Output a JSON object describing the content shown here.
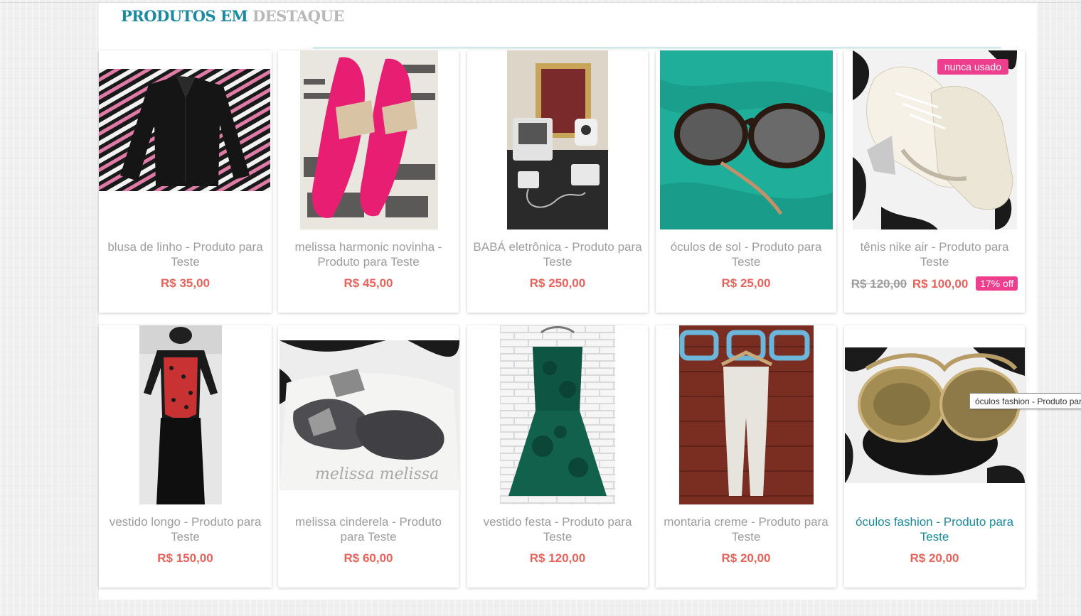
{
  "section": {
    "title_part1": "PRODUTOS EM",
    "title_part2": "DESTAQUE"
  },
  "products": [
    {
      "name": "blusa de linho - Produto para Teste",
      "price": "R$ 35,00",
      "image": "black-blouse-photo"
    },
    {
      "name": "melissa harmonic novinha - Produto para Teste",
      "price": "R$ 45,00",
      "image": "pink-sandals-photo"
    },
    {
      "name": "BABÁ eletrônica - Produto para Teste",
      "price": "R$ 250,00",
      "image": "baby-monitor-photo"
    },
    {
      "name": "óculos de sol - Produto para Teste",
      "price": "R$ 25,00",
      "image": "sunglasses-photo"
    },
    {
      "name": "tênis nike air - Produto para Teste",
      "old_price": "R$ 120,00",
      "price": "R$ 100,00",
      "discount": "17% off",
      "badge": "nunca usado",
      "image": "sneakers-photo"
    },
    {
      "name": "vestido longo - Produto para Teste",
      "price": "R$ 150,00",
      "image": "long-dress-photo"
    },
    {
      "name": "melissa cinderela - Produto para Teste",
      "price": "R$ 60,00",
      "image": "melissa-shoes-photo"
    },
    {
      "name": "vestido festa - Produto para Teste",
      "price": "R$ 120,00",
      "image": "party-dress-photo"
    },
    {
      "name": "montaria creme - Produto para Teste",
      "price": "R$ 20,00",
      "image": "cream-pants-photo"
    },
    {
      "name": "óculos fashion - Produto para Teste",
      "price": "R$ 20,00",
      "image": "fashion-sunglasses-photo"
    }
  ],
  "tooltip": "óculos fashion - Produto para Teste",
  "colors": {
    "accent": "#1b8aa0",
    "price": "#e8625a",
    "badge": "#ee3f8f",
    "muted": "#9d9d9d"
  }
}
